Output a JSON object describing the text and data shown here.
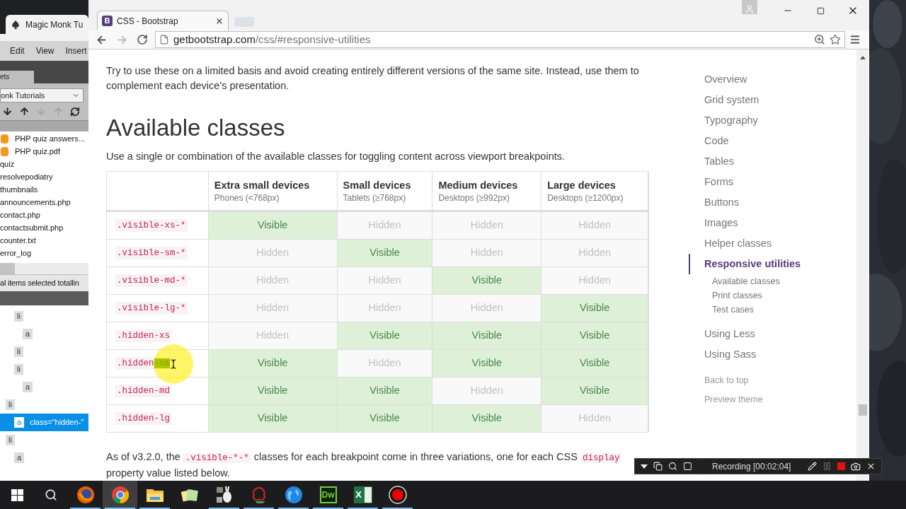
{
  "background_window": {
    "tab_title": "Magic Monk Tu",
    "menu": [
      "Edit",
      "View",
      "Insert"
    ],
    "panel_tab": "ets",
    "site_select": "onk Tutorials",
    "files": [
      {
        "name": "PHP quiz answers...",
        "kind": "pdf"
      },
      {
        "name": "PHP quiz.pdf",
        "kind": "pdf"
      },
      {
        "name": "quiz",
        "kind": "plain"
      },
      {
        "name": "resolvepodiatry",
        "kind": "plain"
      },
      {
        "name": "thumbnails",
        "kind": "plain"
      },
      {
        "name": "announcements.php",
        "kind": "plain"
      },
      {
        "name": "contact.php",
        "kind": "plain"
      },
      {
        "name": "contactsubmit.php",
        "kind": "plain"
      },
      {
        "name": "counter.txt",
        "kind": "plain"
      },
      {
        "name": "error_log",
        "kind": "plain"
      }
    ],
    "status": "al items selected totallin",
    "dom_tree": [
      {
        "children": [
          {
            "tag": "li",
            "selected": false,
            "children": [
              {
                "tag": "a",
                "selected": false
              }
            ]
          },
          {
            "tag": "li",
            "selected": false
          },
          {
            "tag": "li",
            "selected": false,
            "children": [
              {
                "tag": "a",
                "selected": false
              }
            ]
          }
        ]
      },
      {
        "tag": "li",
        "selected": false,
        "children": [
          {
            "tag": "a",
            "selected": true,
            "attribute": "class=\"hidden-\""
          }
        ]
      },
      {
        "tag": "li",
        "selected": false,
        "children": [
          {
            "tag": "a",
            "selected": false
          }
        ]
      }
    ]
  },
  "browser": {
    "tab": {
      "title": "CSS - Bootstrap",
      "favicon": "B"
    },
    "url_host": "getbootstrap.com",
    "url_path": "/css/#responsive-utilities"
  },
  "page": {
    "intro": "Try to use these on a limited basis and avoid creating entirely different versions of the same site. Instead, use them to complement each device's presentation.",
    "heading": "Available classes",
    "lead": "Use a single or combination of the available classes for toggling content across viewport breakpoints.",
    "table": {
      "columns": [
        {
          "title": "Extra small devices",
          "subtitle": "Phones (<768px)"
        },
        {
          "title": "Small devices",
          "subtitle": "Tablets (≥768px)"
        },
        {
          "title": "Medium devices",
          "subtitle": "Desktops (≥992px)"
        },
        {
          "title": "Large devices",
          "subtitle": "Desktops (≥1200px)"
        }
      ],
      "rows": [
        {
          "class_parts": [
            {
              "text": ".visible-xs-*",
              "selected": false
            }
          ],
          "cells": [
            {
              "text": "Visible",
              "visible": true
            },
            {
              "text": "Hidden",
              "visible": false
            },
            {
              "text": "Hidden",
              "visible": false
            },
            {
              "text": "Hidden",
              "visible": false
            }
          ]
        },
        {
          "class_parts": [
            {
              "text": ".visible-sm-*",
              "selected": false
            }
          ],
          "cells": [
            {
              "text": "Hidden",
              "visible": false
            },
            {
              "text": "Visible",
              "visible": true
            },
            {
              "text": "Hidden",
              "visible": false
            },
            {
              "text": "Hidden",
              "visible": false
            }
          ]
        },
        {
          "class_parts": [
            {
              "text": ".visible-md-*",
              "selected": false
            }
          ],
          "cells": [
            {
              "text": "Hidden",
              "visible": false
            },
            {
              "text": "Hidden",
              "visible": false
            },
            {
              "text": "Visible",
              "visible": true
            },
            {
              "text": "Hidden",
              "visible": false
            }
          ]
        },
        {
          "class_parts": [
            {
              "text": ".visible-lg-*",
              "selected": false
            }
          ],
          "cells": [
            {
              "text": "Hidden",
              "visible": false
            },
            {
              "text": "Hidden",
              "visible": false
            },
            {
              "text": "Hidden",
              "visible": false
            },
            {
              "text": "Visible",
              "visible": true
            }
          ]
        },
        {
          "class_parts": [
            {
              "text": ".hidden-xs",
              "selected": false
            }
          ],
          "cells": [
            {
              "text": "Hidden",
              "visible": false
            },
            {
              "text": "Visible",
              "visible": true
            },
            {
              "text": "Visible",
              "visible": true
            },
            {
              "text": "Visible",
              "visible": true
            }
          ]
        },
        {
          "class_parts": [
            {
              "text": ".hidden",
              "selected": false
            },
            {
              "text": "-sm",
              "selected": true
            }
          ],
          "cells": [
            {
              "text": "Visible",
              "visible": true
            },
            {
              "text": "Hidden",
              "visible": false
            },
            {
              "text": "Visible",
              "visible": true
            },
            {
              "text": "Visible",
              "visible": true
            }
          ]
        },
        {
          "class_parts": [
            {
              "text": ".hidden-md",
              "selected": false
            }
          ],
          "cells": [
            {
              "text": "Visible",
              "visible": true
            },
            {
              "text": "Visible",
              "visible": true
            },
            {
              "text": "Hidden",
              "visible": false
            },
            {
              "text": "Visible",
              "visible": true
            }
          ]
        },
        {
          "class_parts": [
            {
              "text": ".hidden-lg",
              "selected": false
            }
          ],
          "cells": [
            {
              "text": "Visible",
              "visible": true
            },
            {
              "text": "Visible",
              "visible": true
            },
            {
              "text": "Visible",
              "visible": true
            },
            {
              "text": "Hidden",
              "visible": false
            }
          ]
        }
      ]
    },
    "note": [
      {
        "kind": "text",
        "text": "As of v3.2.0, the "
      },
      {
        "kind": "code",
        "text": ".visible-*-*"
      },
      {
        "kind": "text",
        "text": " classes for each breakpoint come in three variations, one for each CSS "
      },
      {
        "kind": "code",
        "text": "display"
      },
      {
        "kind": "text",
        "text": " property value listed below."
      }
    ]
  },
  "sidebar": {
    "items": [
      {
        "label": "Overview",
        "selected": false
      },
      {
        "label": "Grid system",
        "selected": false
      },
      {
        "label": "Typography",
        "selected": false
      },
      {
        "label": "Code",
        "selected": false
      },
      {
        "label": "Tables",
        "selected": false
      },
      {
        "label": "Forms",
        "selected": false
      },
      {
        "label": "Buttons",
        "selected": false
      },
      {
        "label": "Images",
        "selected": false
      },
      {
        "label": "Helper classes",
        "selected": false
      },
      {
        "label": "Responsive utilities",
        "selected": true,
        "children": [
          {
            "label": "Available classes",
            "selected": false
          },
          {
            "label": "Print classes",
            "selected": false
          },
          {
            "label": "Test cases",
            "selected": false
          }
        ]
      },
      {
        "label": "Using Less",
        "selected": false
      },
      {
        "label": "Using Sass",
        "selected": false
      }
    ],
    "links": [
      "Back to top",
      "Preview theme"
    ]
  },
  "recorder": {
    "status": "Recording [00:02:04]"
  },
  "taskbar": {
    "apps": [
      {
        "kind": "firefox",
        "running": true,
        "selected": false
      },
      {
        "kind": "chrome",
        "running": true,
        "selected": true
      },
      {
        "kind": "explorer",
        "running": true,
        "selected": false
      },
      {
        "kind": "notes",
        "running": false,
        "selected": false
      },
      {
        "kind": "rabbit",
        "running": true,
        "selected": false
      },
      {
        "kind": "flower",
        "running": true,
        "selected": false
      },
      {
        "kind": "globe",
        "running": true,
        "selected": false
      },
      {
        "kind": "dw",
        "label": "Dw",
        "running": true,
        "selected": false
      },
      {
        "kind": "excel",
        "label": "X",
        "running": true,
        "selected": false
      },
      {
        "kind": "record",
        "running": true,
        "selected": false
      }
    ]
  }
}
